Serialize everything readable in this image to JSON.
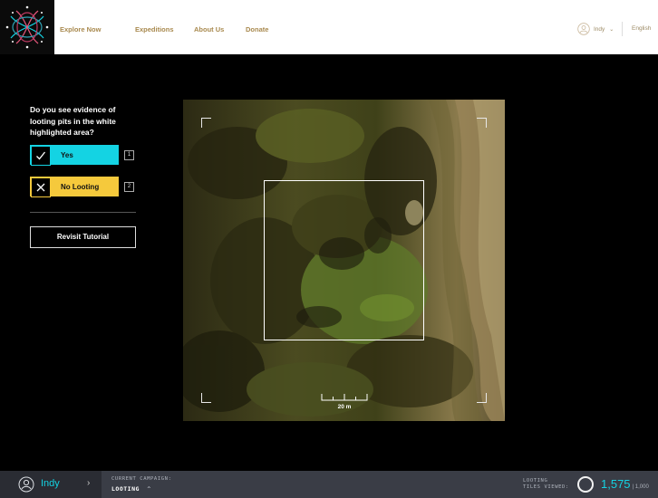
{
  "nav": {
    "links": [
      "Explore Now",
      "Expeditions",
      "About Us",
      "Donate"
    ],
    "user": "Indy",
    "language": "English"
  },
  "task": {
    "question": "Do you see evidence of looting pits in the white highlighted area?",
    "answers": [
      {
        "label": "Yes",
        "key": "1",
        "color": "#14d3e3",
        "icon": "check-icon"
      },
      {
        "label": "No Looting",
        "key": "2",
        "color": "#f5c93c",
        "icon": "x-icon"
      }
    ],
    "revisit": "Revisit Tutorial"
  },
  "tile": {
    "scale_label": "20 m"
  },
  "status": {
    "user": "Indy",
    "campaign_label": "CURRENT CAMPAIGN:",
    "campaign_value": "LOOTING",
    "tiles_label_1": "LOOTING",
    "tiles_label_2": "TILES VIEWED:",
    "tiles_viewed": "1,575",
    "tiles_total": "| 1,000",
    "progress_fraction": 1.0
  },
  "colors": {
    "accent": "#14d3e3",
    "warning": "#f5c93c",
    "nav_text": "#a8894e"
  }
}
